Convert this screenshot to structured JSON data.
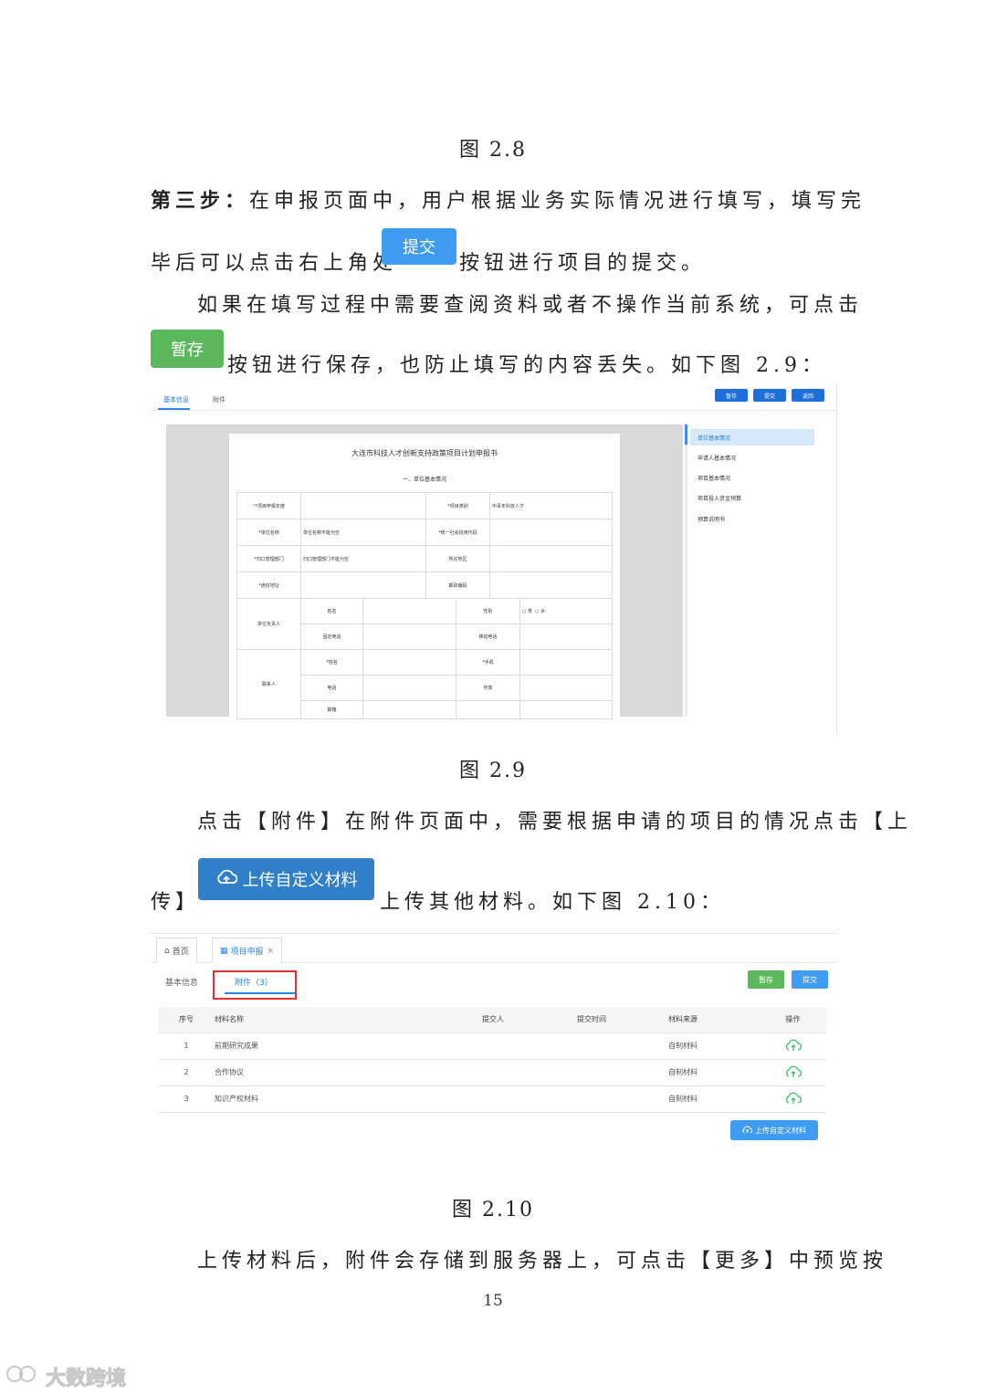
{
  "captions": {
    "fig_2_8": "图 2.8",
    "fig_2_9": "图 2.9",
    "fig_2_10": "图 2.10"
  },
  "step3": {
    "label": "第三步：",
    "line1": "在申报页面中，用户根据业务实际情况进行填写，填写完",
    "line2a": "毕后可以点击右上角处",
    "submit_button": "提交",
    "line2b": "按钮进行项目的提交。"
  },
  "save_para": {
    "line1": "如果在填写过程中需要查阅资料或者不操作当前系统，可点击",
    "save_button": "暂存",
    "line2": "按钮进行保存，也防止填写的内容丢失。如下图 2.9："
  },
  "fig9": {
    "tabs": [
      "基本信息",
      "附件"
    ],
    "buttons": [
      "暂存",
      "提交",
      "返回"
    ],
    "doc_title": "大连市科技人才创新支持政策项目计划申报书",
    "section": "一、单位基本情况",
    "rows": {
      "r1": [
        "*项目申报年度",
        "*项目类别",
        "中青年科技人才"
      ],
      "r2": [
        "*单位名称",
        "单位名称不能为空",
        "*统一社会信用代码"
      ],
      "r3": [
        "*归口管理部门",
        "归口管理部门不能为空",
        "所在地区"
      ],
      "r4": [
        "*通信地址",
        "邮政编码"
      ],
      "leader": [
        "单位负责人",
        "姓名",
        "性别",
        "男",
        "女",
        "固定电话",
        "移动电话"
      ],
      "contact": [
        "联系人",
        "*姓名",
        "*手机",
        "电话",
        "传真",
        "邮箱"
      ]
    },
    "nav": [
      "单位基本情况",
      "申请人基本情况",
      "项目基本情况",
      "项目投入资金预算",
      "预算说明书"
    ]
  },
  "attach_para": {
    "line1": "点击【附件】在附件页面中，需要根据申请的项目的情况点击【上",
    "line2a": "传】",
    "upload_button": "上传自定义材料",
    "line2b": "上传其他材料。如下图 2.10："
  },
  "fig10": {
    "tabs": [
      "首页",
      "项目申报"
    ],
    "subtabs": [
      "基本信息",
      "附件（3）"
    ],
    "buttons": [
      "暂存",
      "提交"
    ],
    "headers": [
      "序号",
      "材料名称",
      "提交人",
      "提交时间",
      "材料来源",
      "操作"
    ],
    "rows": [
      [
        "1",
        "前期研究成果",
        "自制材料"
      ],
      [
        "2",
        "合作协议",
        "自制材料"
      ],
      [
        "3",
        "知识产权材料",
        "自制材料"
      ]
    ],
    "upload_button": "上传自定义材料"
  },
  "last_para": "上传材料后，附件会存储到服务器上，可点击【更多】中预览按",
  "page_number": "15",
  "watermark": "大数跨境",
  "colors": {
    "blue": "#3f9cf0",
    "green": "#5cb85c",
    "upload": "#2f7fc9",
    "error": "#e33333"
  }
}
